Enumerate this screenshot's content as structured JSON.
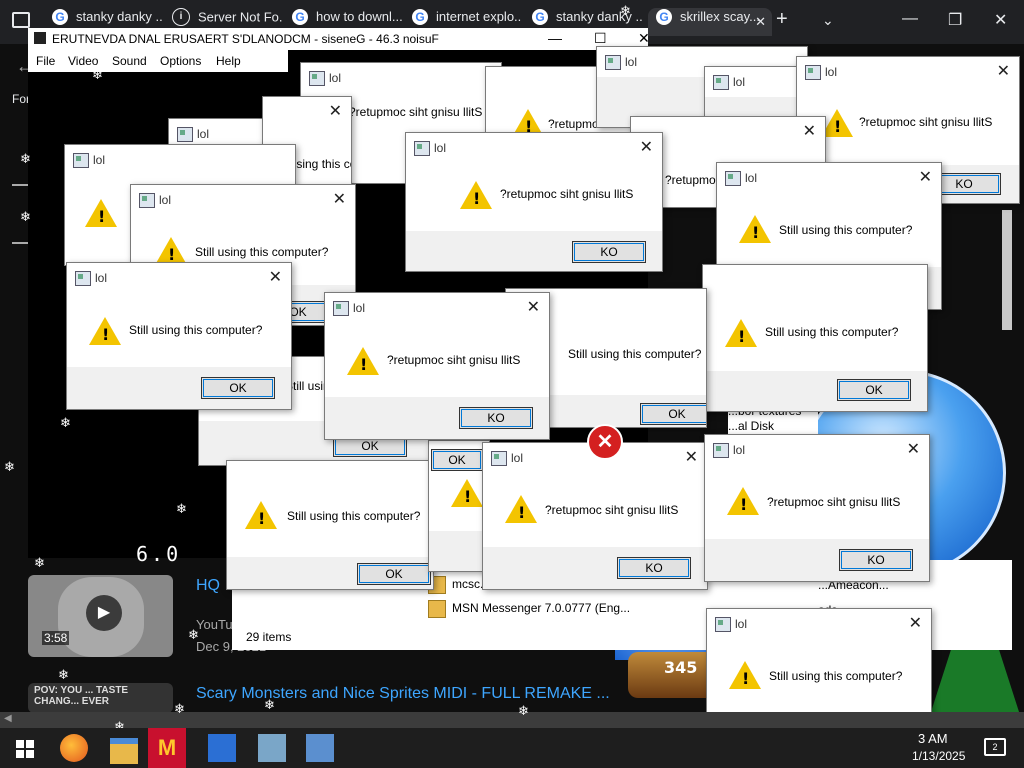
{
  "browser": {
    "tabs": [
      {
        "label": "stanky danky ..."
      },
      {
        "label": "Server Not Fo..."
      },
      {
        "label": "how to downl..."
      },
      {
        "label": "internet explo..."
      },
      {
        "label": "stanky danky ..."
      },
      {
        "label": "skrillex scay..."
      }
    ],
    "new_tab": "+",
    "tab_close": "✕",
    "minimize": "—",
    "maximize": "❐",
    "close": "✕"
  },
  "left_pane": {
    "fo": "For"
  },
  "emulator": {
    "title": "ERUTNEVDA DNAL ERUSAERT   S'DLANODCM - siseneG - 46.3 noisuF",
    "menu": [
      "File",
      "Video",
      "Sound",
      "Options",
      "Help"
    ],
    "fps": "6.0",
    "minimize": "—",
    "maximize": "☐",
    "close": "✕"
  },
  "youtube": {
    "video1": {
      "duration": "3:58",
      "title": "HQ",
      "meta1": "YouTu",
      "meta2": "Dec 9, 2021"
    },
    "video2": {
      "title": "Scary Monsters and Nice Sprites MIDI - FULL REMAKE ...",
      "thumb_text": "POV: YOU ... TASTE CHANG... EVER"
    }
  },
  "explorer": {
    "items": [
      "mcsc...",
      "MSN Messenger 7.0.0777 (Eng..."
    ],
    "count": "29 items",
    "detail": [
      "...bor textures",
      "...al Disk (C:)\\Pr...",
      "...ads",
      "...Ameacon..."
    ]
  },
  "globe": {
    "number": "345"
  },
  "dialogs": [
    {
      "title": "lol",
      "message": "?retupmoc siht gnisu llitS",
      "ok": "KO"
    },
    {
      "title": "lol",
      "message": "Still using this computer?",
      "ok": "OK"
    },
    {
      "title": "lol",
      "message": "?retupmoc siht gnisu llitS",
      "ok": "KO"
    },
    {
      "title": "lol",
      "message": "Still using this computer?",
      "ok": "OK"
    },
    {
      "title": "lol",
      "message": "Still using this computer?",
      "ok": "OK"
    }
  ],
  "taskbar": {
    "time": "3 AM",
    "date": "1/13/2025",
    "notifications": "2"
  },
  "colors": {
    "link": "#3ea6ff",
    "warning": "#f3c400",
    "error": "#d42020",
    "focus": "#0078d7"
  }
}
